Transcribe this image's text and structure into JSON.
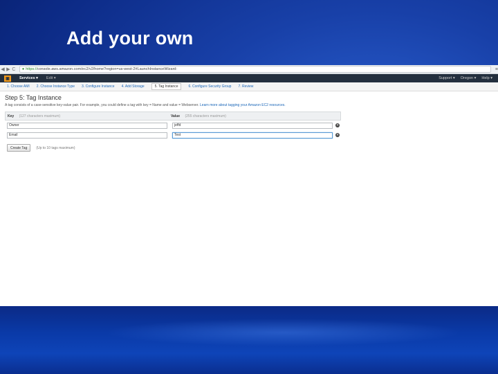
{
  "slide": {
    "title": "Add your own"
  },
  "browser": {
    "url_scheme": "https://",
    "url_rest": "console.aws.amazon.com/ec2/v2/home?region=us-west-2#LaunchInstanceWizard:",
    "back_glyph": "◀",
    "forward_glyph": "▶",
    "reload_glyph": "C",
    "menu_glyph": "≡"
  },
  "awsbar": {
    "logo_glyph": "▣",
    "services_label": "Services ▾",
    "edit_label": "Edit ▾",
    "region": "Oregon ▾",
    "account": "Support ▾",
    "help": "Help ▾"
  },
  "steps": [
    "1. Choose AMI",
    "2. Choose Instance Type",
    "3. Configure Instance",
    "4. Add Storage",
    "5. Tag Instance",
    "6. Configure Security Group",
    "7. Review"
  ],
  "active_step": 4,
  "content": {
    "title": "Step 5: Tag Instance",
    "description": "A tag consists of a case-sensitive key-value pair. For example, you could define a tag with key = Name and value = Webserver.",
    "learn_more": "Learn more about tagging your Amazon EC2 resources."
  },
  "table": {
    "key_header": "Key",
    "key_hint": "(127 characters maximum)",
    "value_header": "Value",
    "value_hint": "(255 characters maximum)",
    "rows": [
      {
        "key": "Owner",
        "value": "jeffd"
      },
      {
        "key": "Email",
        "value": "Test"
      }
    ],
    "remove_glyph": "✕"
  },
  "actions": {
    "create_tag_label": "Create Tag",
    "limit_text": "(Up to 10 tags maximum)"
  }
}
